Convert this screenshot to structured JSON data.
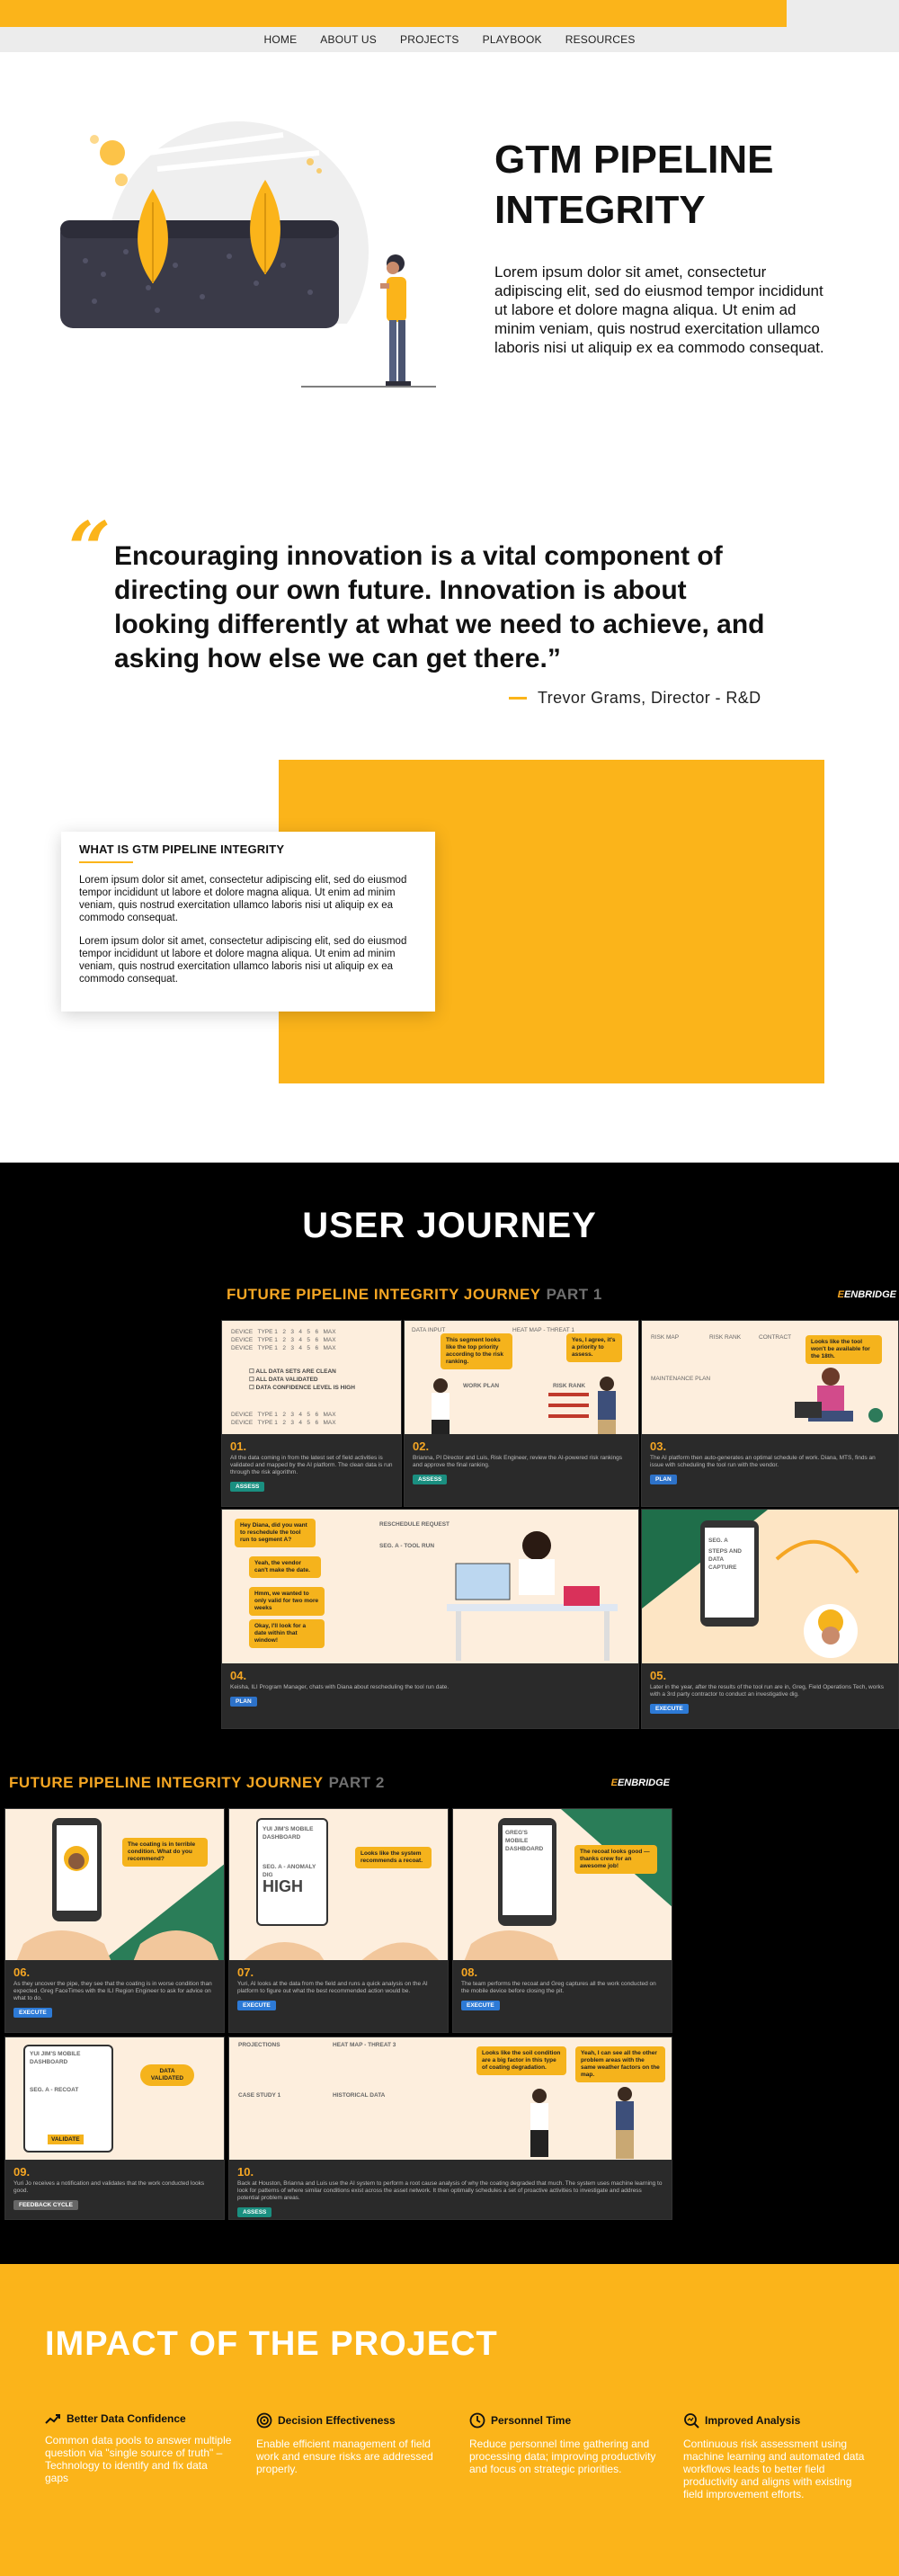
{
  "nav": {
    "items": [
      "HOME",
      "ABOUT US",
      "PROJECTS",
      "PLAYBOOK",
      "RESOURCES"
    ]
  },
  "hero": {
    "title": "GTM PIPELINE INTEGRITY",
    "description": "Lorem ipsum dolor sit amet, consectetur adipiscing elit, sed do eiusmod tempor incididunt ut labore et dolore magna aliqua. Ut enim ad minim veniam, quis nostrud exercitation ullamco laboris nisi ut aliquip ex ea commodo consequat."
  },
  "quote": {
    "mark": "“",
    "text": "Encouraging innovation is a vital component of directing our own future. Innovation is about looking differently at what we need to achieve, and asking how else we can get there.”",
    "author": "Trevor Grams, Director - R&D"
  },
  "about": {
    "heading": "WHAT IS GTM PIPELINE INTEGRITY",
    "paragraphs": [
      "Lorem ipsum dolor sit amet, consectetur adipiscing elit, sed do eiusmod tempor incididunt ut labore et dolore magna aliqua. Ut enim ad minim veniam, quis nostrud exercitation ullamco laboris nisi ut aliquip ex ea commodo consequat.",
      "Lorem ipsum dolor sit amet, consectetur adipiscing elit, sed do eiusmod tempor incididunt ut labore et dolore magna aliqua. Ut enim ad minim veniam, quis nostrud exercitation ullamco laboris nisi ut aliquip ex ea commodo consequat."
    ]
  },
  "journey": {
    "title": "USER JOURNEY",
    "brand": "ENBRIDGE",
    "board1": {
      "title": "FUTURE PIPELINE INTEGRITY JOURNEY",
      "part": "PART 1",
      "panels": [
        {
          "num": "01.",
          "caption": "All the data coming in from the latest set of field activities is validated and mapped by the AI platform. The clean data is run through the risk algorithm.",
          "tag": "ASSESS",
          "bubbles": [],
          "lines": [
            "ALL DATA SETS ARE CLEAN",
            "ALL DATA VALIDATED",
            "DATA CONFIDENCE LEVEL IS HIGH"
          ]
        },
        {
          "num": "02.",
          "caption": "Brianna, PI Director and Luis, Risk Engineer, review the AI-powered risk rankings and approve the final ranking.",
          "tag": "ASSESS",
          "bubbles": [
            "This segment looks like the top priority according to the risk ranking.",
            "Yes, I agree, it's a priority to assess."
          ],
          "lines": [
            "DATA INPUT",
            "HEAT MAP - THREAT 1",
            "WORK PLAN",
            "RISK RANK"
          ]
        },
        {
          "num": "03.",
          "caption": "The AI platform then auto-generates an optimal schedule of work. Diana, MTS, finds an issue with scheduling the tool run with the vendor.",
          "tag": "PLAN",
          "bubbles": [
            "Looks like the tool won't be available for the 18th."
          ],
          "lines": [
            "RISK MAP",
            "RISK RANK",
            "CONTRACT",
            "MAINTENANCE PLAN"
          ]
        },
        {
          "num": "04.",
          "caption": "Keisha, ILI Program Manager, chats with Diana about rescheduling the tool run date.",
          "tag": "PLAN",
          "bubbles": [
            "Hey Diana, did you want to reschedule the tool run to segment A?",
            "Yeah, the vendor can't make the date.",
            "Hmm, we wanted to only valid for two more weeks",
            "Okay, I'll look for a date within that window!"
          ],
          "lines": [
            "RESCHEDULE REQUEST",
            "SEG. A - TOOL RUN"
          ]
        },
        {
          "num": "05.",
          "caption": "Later in the year, after the results of the tool run are in, Greg, Field Operations Tech, works with a 3rd party contractor to conduct an investigative dig.",
          "tag": "EXECUTE",
          "bubbles": [],
          "lines": [
            "SEG. A",
            "STEPS AND DATA CAPTURE"
          ]
        }
      ]
    },
    "board2": {
      "title": "FUTURE PIPELINE INTEGRITY JOURNEY",
      "part": "PART 2",
      "panels": [
        {
          "num": "06.",
          "caption": "As they uncover the pipe, they see that the coating is in worse condition than expected. Greg FaceTimes with the ILI Region Engineer to ask for advice on what to do.",
          "tag": "EXECUTE",
          "bubbles": [
            "The coating is in terrible condition. What do you recommend?"
          ],
          "lines": []
        },
        {
          "num": "07.",
          "caption": "Yuri, AI looks at the data from the field and runs a quick analysis on the AI platform to figure out what the best recommended action would be.",
          "tag": "EXECUTE",
          "bubbles": [
            "Looks like the system recommends a recoat."
          ],
          "lines": [
            "YUI JIM'S MOBILE DASHBOARD",
            "SEG. A - ANOMALY DIG",
            "HIGH"
          ]
        },
        {
          "num": "08.",
          "caption": "The team performs the recoat and Greg captures all the work conducted on the mobile device before closing the pit.",
          "tag": "EXECUTE",
          "bubbles": [
            "The recoat looks good — thanks crew for an awesome job!"
          ],
          "lines": [
            "GREG'S MOBILE DASHBOARD"
          ]
        },
        {
          "num": "09.",
          "caption": "Yuri Jo receives a notification and validates that the work conducted looks good.",
          "tag": "FEEDBACK CYCLE",
          "bubbles": [
            "DATA VALIDATED"
          ],
          "lines": [
            "YUI JIM'S MOBILE DASHBOARD",
            "SEG. A - RECOAT",
            "VALIDATE"
          ]
        },
        {
          "num": "10.",
          "caption": "Back at Houston, Brianna and Luis use the AI system to perform a root cause analysis of why the coating degraded that much. The system uses machine learning to look for patterns of where similar conditions exist across the asset network. It then optimally schedules a set of proactive activities to investigate and address potential problem areas.",
          "tag": "ASSESS",
          "bubbles": [
            "Looks like the soil condition are a big factor in this type of coating degradation.",
            "Yeah, I can see all the other problem areas with the same weather factors on the map."
          ],
          "lines": [
            "PROJECTIONS",
            "HEAT MAP - THREAT 3",
            "CASE STUDY 1",
            "HISTORICAL DATA"
          ]
        }
      ]
    }
  },
  "impact": {
    "title": "IMPACT OF THE PROJECT",
    "items": [
      {
        "icon": "trend-up-icon",
        "heading": "Better Data Confidence",
        "text": "Common data pools to answer multiple question via \"single source of truth\" – Technology to identify and fix data gaps"
      },
      {
        "icon": "target-icon",
        "heading": "Decision Effectiveness",
        "text": "Enable efficient management of field work and ensure risks are addressed properly."
      },
      {
        "icon": "clock-icon",
        "heading": "Personnel Time",
        "text": "Reduce personnel time gathering and processing data; improving productivity and focus on strategic priorities."
      },
      {
        "icon": "analysis-icon",
        "heading": "Improved Analysis",
        "text": "Continuous risk assessment using machine learning and automated data workflows leads to better field productivity and aligns with existing field improvement efforts."
      }
    ]
  },
  "colors": {
    "accent": "#fbb41a",
    "dark": "#000000",
    "panel": "#fdeedd"
  }
}
